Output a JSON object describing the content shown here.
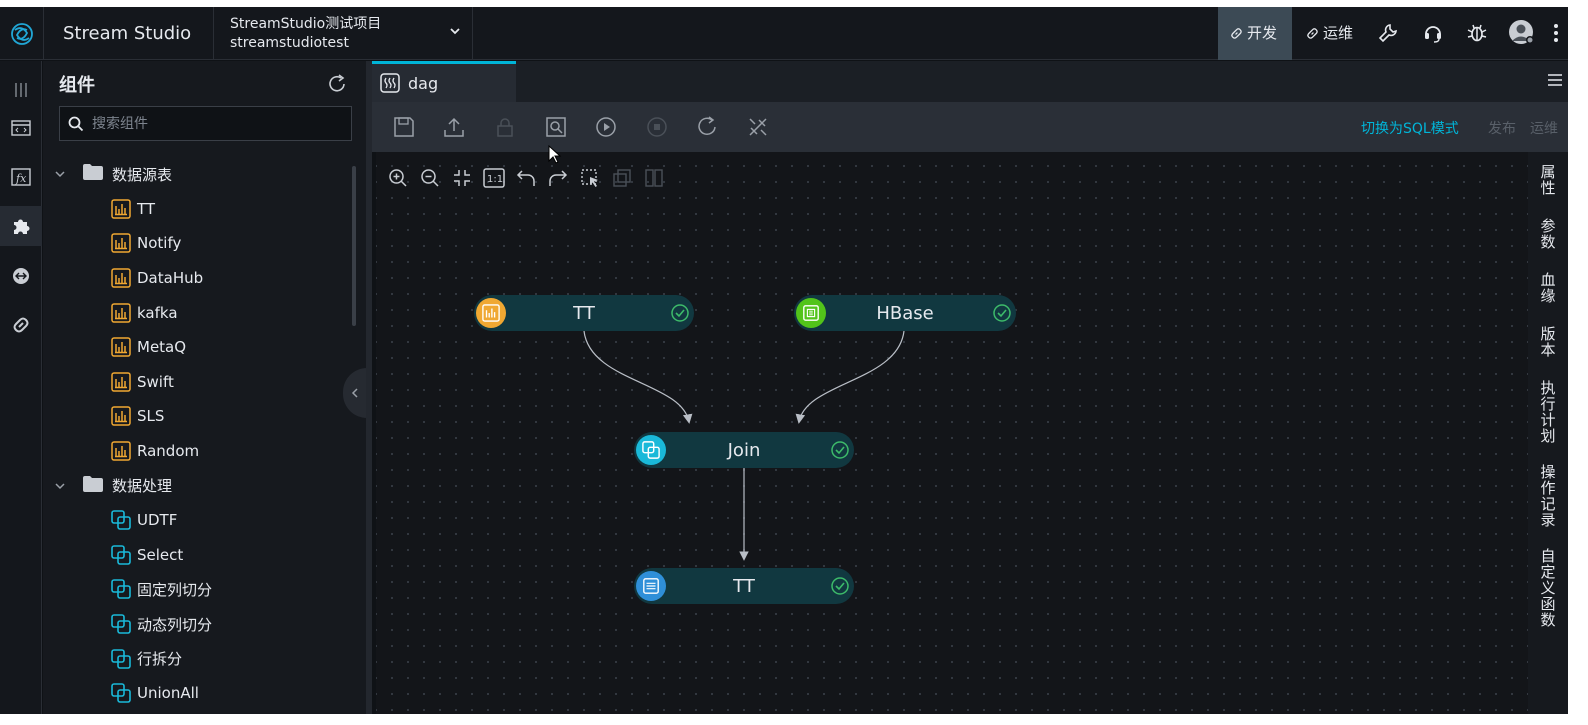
{
  "topbar": {
    "app_title": "Stream Studio",
    "project_name": "StreamStudio测试项目",
    "project_code": "streamstudiotest",
    "modes": [
      {
        "label": "开发",
        "icon": "link-icon",
        "active": true
      },
      {
        "label": "运维",
        "icon": "link-icon",
        "active": false
      }
    ],
    "icons": [
      "wrench-icon",
      "headset-icon",
      "bug-icon",
      "avatar",
      "more-vertical-icon"
    ]
  },
  "rail": {
    "items": [
      "columns-icon",
      "code-window-icon",
      "function-icon",
      "puzzle-icon",
      "circle-arrow-icon",
      "link-icon"
    ],
    "active_index": 3
  },
  "panel": {
    "title": "组件",
    "search_placeholder": "搜索组件",
    "groups": [
      {
        "label": "数据源表",
        "items": [
          "TT",
          "Notify",
          "DataHub",
          "kafka",
          "MetaQ",
          "Swift",
          "SLS",
          "Random"
        ]
      },
      {
        "label": "数据处理",
        "items": [
          "UDTF",
          "Select",
          "固定列切分",
          "动态列切分",
          "行拆分",
          "UnionAll"
        ]
      }
    ]
  },
  "editor": {
    "tab_label": "dag",
    "toolbar": {
      "switch_sql": "切换为SQL模式",
      "publish": "发布",
      "ops": "运维"
    }
  },
  "dag": {
    "nodes": [
      {
        "id": "tt-source",
        "label": "TT",
        "icon_color": "#f0a832",
        "status": "ok"
      },
      {
        "id": "hbase-source",
        "label": "HBase",
        "icon_color": "#52c41a",
        "status": "ok"
      },
      {
        "id": "join",
        "label": "Join",
        "icon_color": "#1ab9d9",
        "status": "ok"
      },
      {
        "id": "tt-sink",
        "label": "TT",
        "icon_color": "#2f8fd8",
        "status": "ok"
      }
    ],
    "edges": [
      [
        "tt-source",
        "join"
      ],
      [
        "hbase-source",
        "join"
      ],
      [
        "join",
        "tt-sink"
      ]
    ]
  },
  "right_sidebar": {
    "items": [
      "属性",
      "参数",
      "血缘",
      "版本",
      "执行计划",
      "操作记录",
      "自定义函数"
    ]
  },
  "colors": {
    "accent": "#00b5d8",
    "source_icon": "#f0a832",
    "processing_icon": "#1ab9d9",
    "node_bg": "#113840",
    "status_ok": "#3dbb6a"
  }
}
